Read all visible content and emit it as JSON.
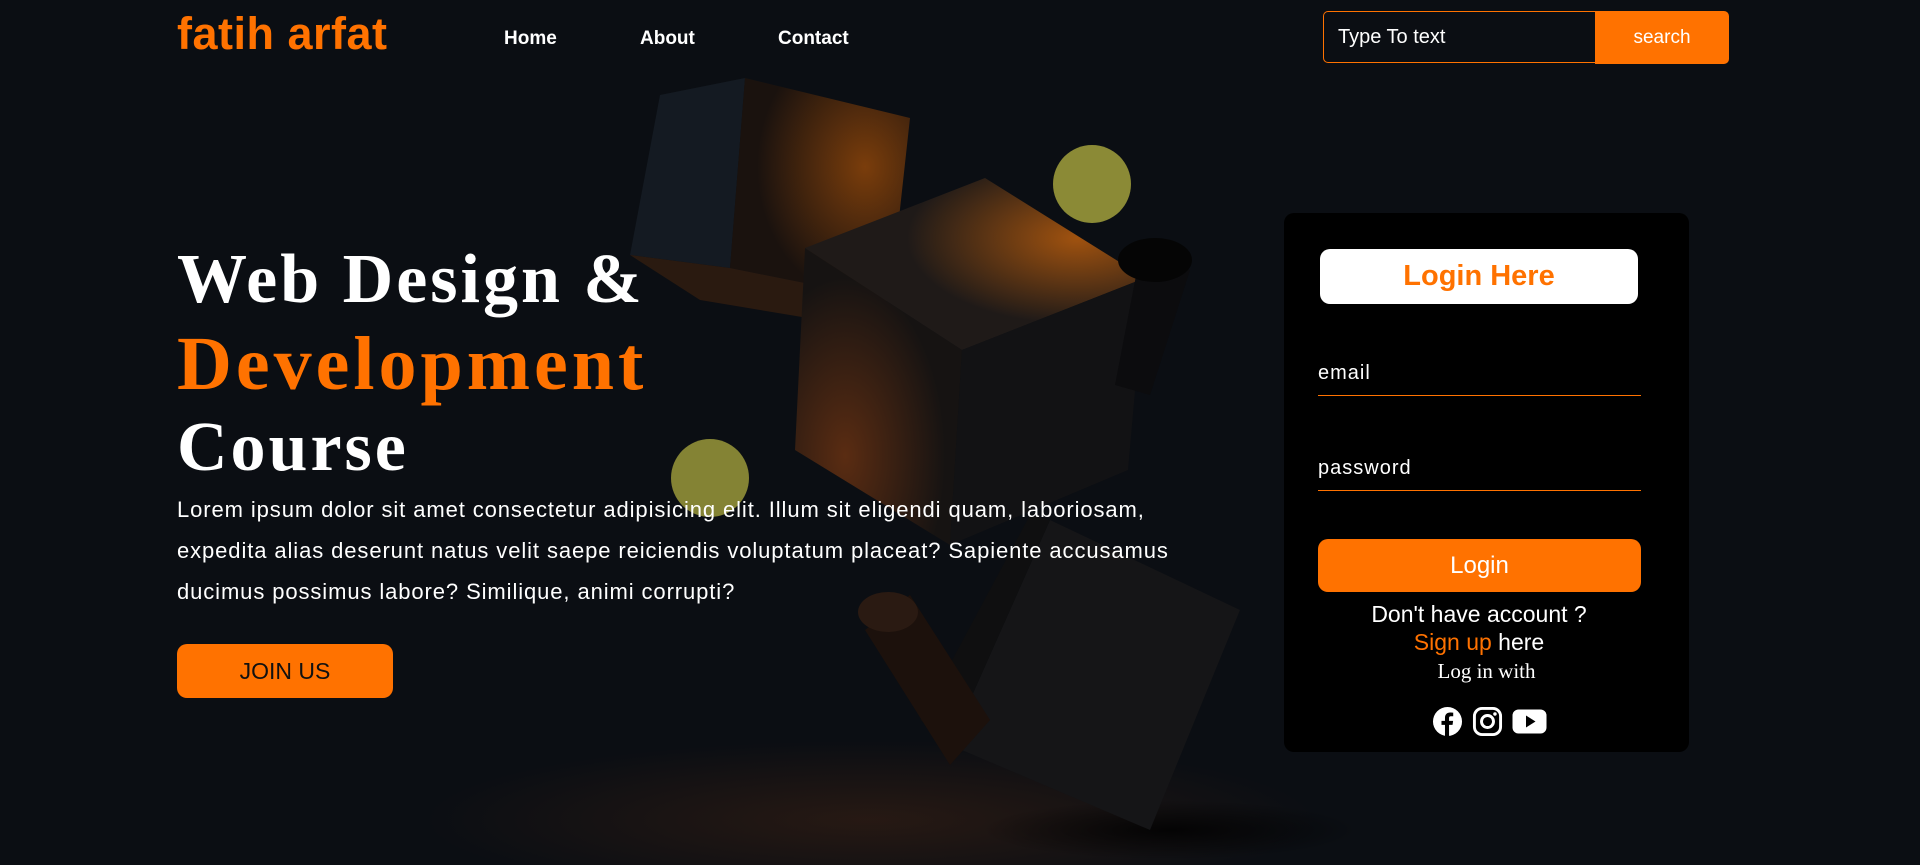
{
  "header": {
    "brand": "fatih arfat",
    "nav": [
      {
        "label": "Home"
      },
      {
        "label": "About"
      },
      {
        "label": "Contact"
      }
    ],
    "search": {
      "placeholder": "Type To text",
      "button_label": "search"
    }
  },
  "hero": {
    "title_line1": "Web Design &",
    "title_line2": "Development",
    "title_line3": "Course",
    "description": "Lorem ipsum dolor sit amet consectetur adipisicing elit. Illum sit eligendi quam, laboriosam, expedita alias deserunt natus velit saepe reiciendis voluptatum placeat? Sapiente accusamus ducimus possimus labore? Similique, animi corrupti?",
    "join_label": "JOIN US"
  },
  "login": {
    "title": "Login Here",
    "email_placeholder": "email",
    "password_placeholder": "password",
    "button_label": "Login",
    "no_account": "Don't have account ?",
    "signup_link": "Sign up",
    "signup_suffix": "here",
    "login_with": "Log in with",
    "social_icons": [
      "facebook-icon",
      "instagram-icon",
      "youtube-icon"
    ]
  },
  "colors": {
    "accent": "#ff7200",
    "background": "#0b0e13",
    "card": "#000000",
    "orb": "#8b8a36"
  }
}
